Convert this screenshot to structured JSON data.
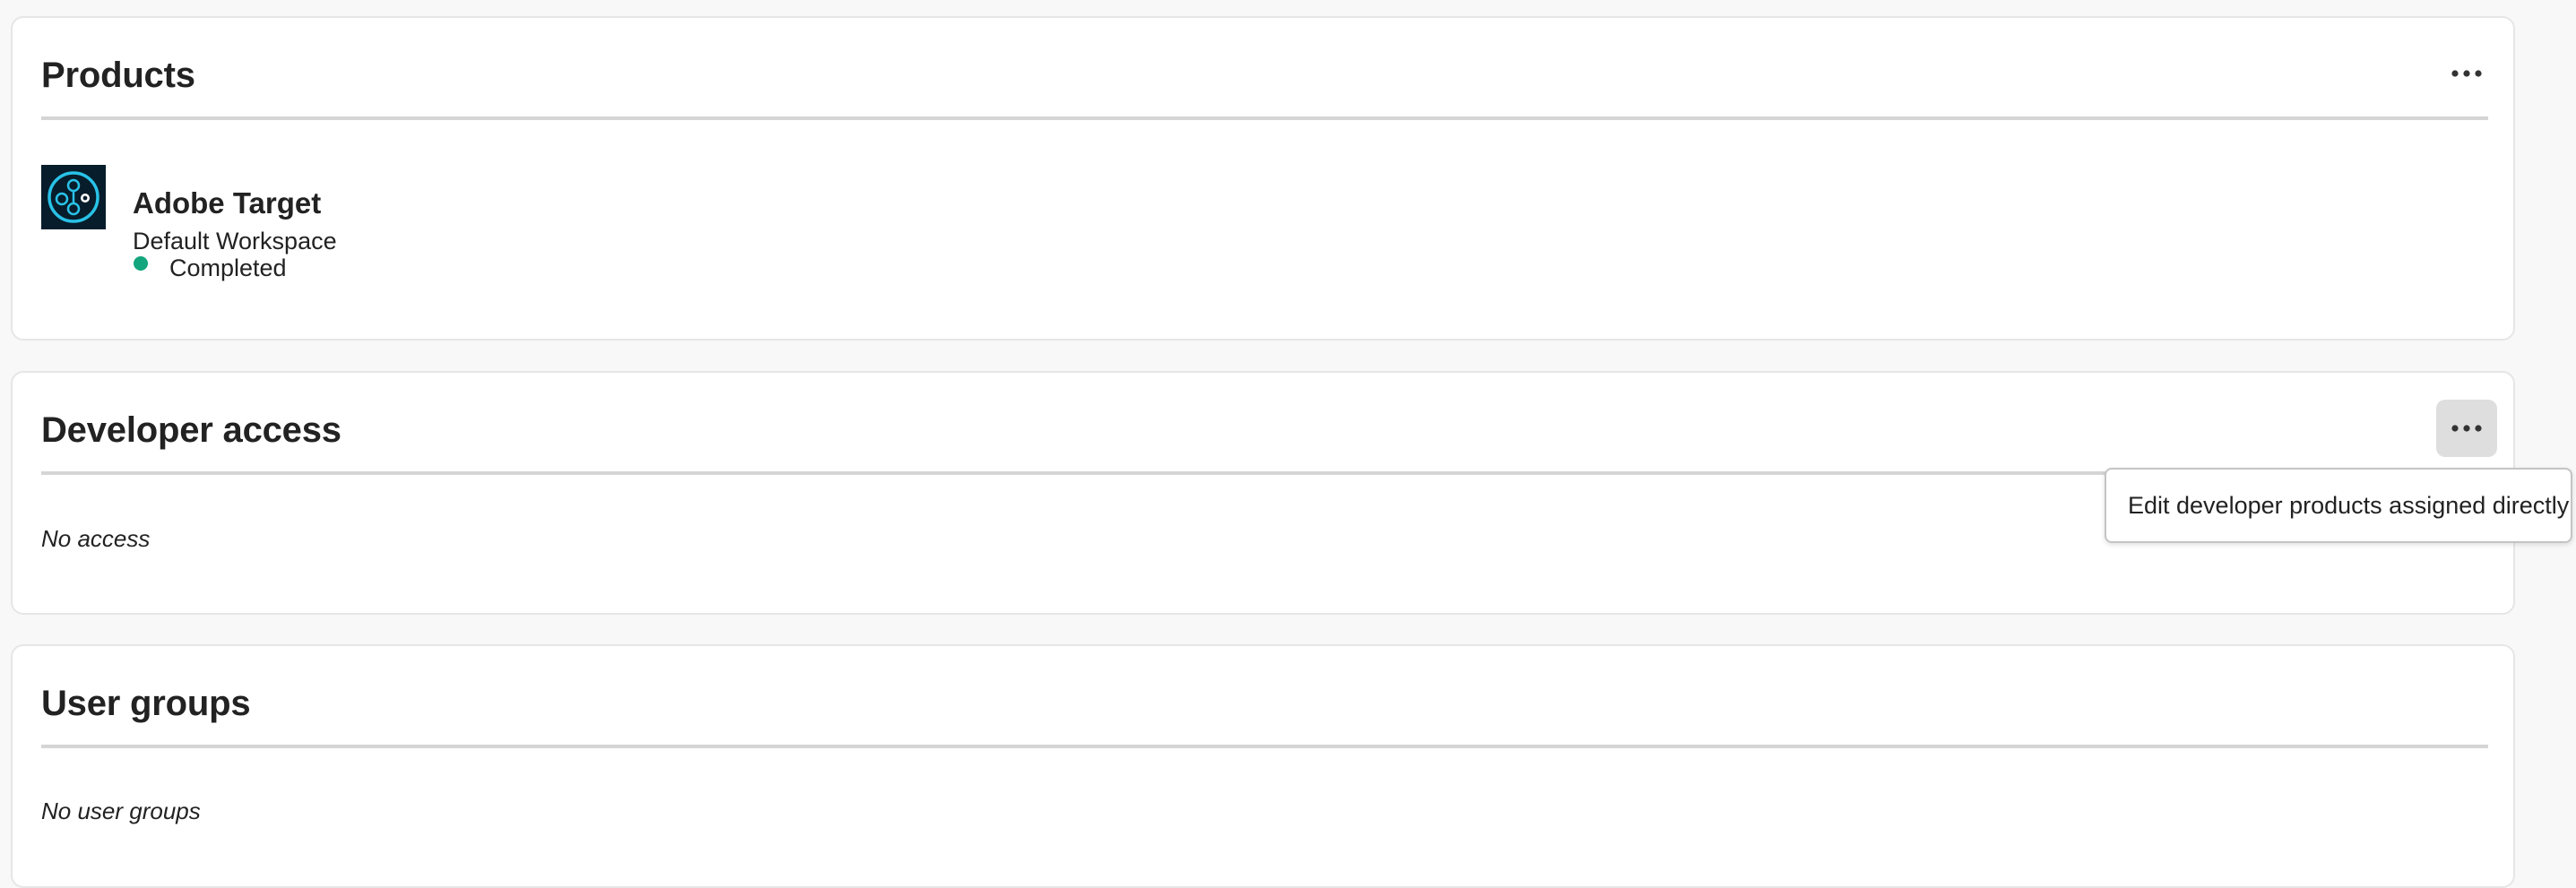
{
  "products_card": {
    "title": "Products",
    "more_icon": "more-horizontal-icon",
    "items": [
      {
        "name": "Adobe Target",
        "workspace": "Default Workspace",
        "status": "Completed",
        "status_color": "#12a57e",
        "icon": "adobe-target-icon"
      }
    ]
  },
  "developer_card": {
    "title": "Developer access",
    "more_icon": "more-horizontal-icon",
    "empty_text": "No access",
    "menu_open": true
  },
  "groups_card": {
    "title": "User groups",
    "empty_text": "No user groups"
  },
  "popover": {
    "items": [
      {
        "label": "Edit developer products assigned directly"
      }
    ]
  },
  "colors": {
    "background": "#f8f8f8",
    "card": "#ffffff",
    "divider": "#d5d5d5",
    "status_completed": "#12a57e",
    "target_icon_bg": "#071d2b",
    "target_icon_accent": "#29c2e8"
  }
}
